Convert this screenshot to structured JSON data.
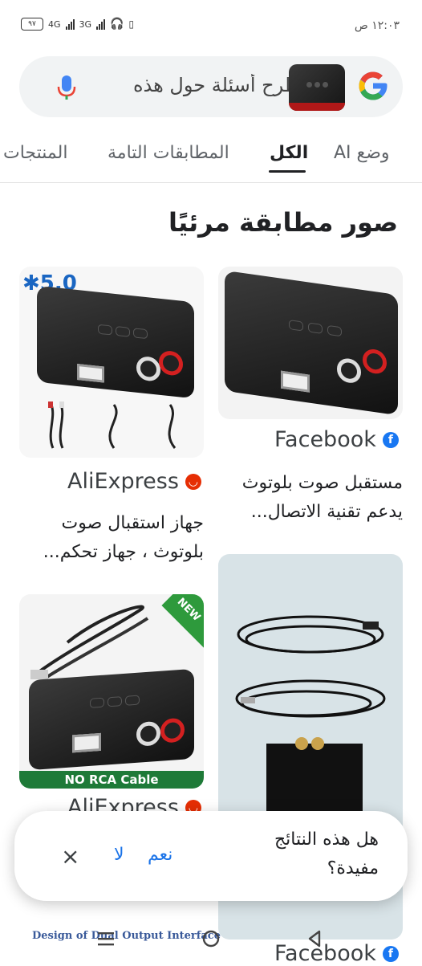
{
  "status_bar": {
    "battery": "٩٧",
    "network_1": "4G",
    "network_2": "3G",
    "time": "١٢:٠٣ ص"
  },
  "search": {
    "query": "طرح أسئلة حول هذه",
    "mic_icon": "mic-icon",
    "logo": "google-g-logo"
  },
  "tabs": [
    {
      "label": "وضع AI",
      "active": false
    },
    {
      "label": "الكل",
      "active": true
    },
    {
      "label": "المطابقات التامة",
      "active": false
    },
    {
      "label": "المنتجات",
      "active": false
    }
  ],
  "section_title": "صور مطابقة مرئيًا",
  "results": [
    {
      "source": "Facebook",
      "source_color": "#1877f2",
      "description": "مستقبل صوت بلوتوث يدعم تقنية الاتصال..."
    },
    {
      "source": "AliExpress",
      "source_color": "#e62e04",
      "badge": "5.0",
      "description": "جهاز استقبال صوت بلوتوث ، جهاز تحكم..."
    },
    {
      "source": "AliExpress",
      "source_color": "#e62e04",
      "banner": "NO RCA Cable",
      "corner": "NEW"
    },
    {
      "source": "Facebook",
      "source_color": "#1877f2"
    }
  ],
  "bottom_caption": "Design of Dual Output Interface",
  "feedback": {
    "question": "هل هذه النتائج مفيدة؟",
    "yes": "نعم",
    "no": "لا",
    "close": "×"
  }
}
